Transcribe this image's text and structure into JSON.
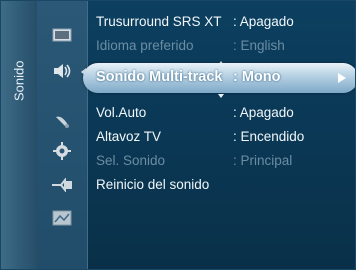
{
  "menu": {
    "category": "Sonido",
    "rows": [
      {
        "label": "Trusurround SRS XT",
        "value": ": Apagado"
      },
      {
        "label": "Idioma preferido",
        "value": ": English"
      },
      {
        "label": "Sonido Multi-track",
        "value": ": Mono"
      },
      {
        "label": "Vol.Auto",
        "value": ": Apagado"
      },
      {
        "label": "Altavoz TV",
        "value": ": Encendido"
      },
      {
        "label": "Sel. Sonido",
        "value": ": Principal"
      },
      {
        "label": "Reinicio del sonido",
        "value": ""
      }
    ]
  },
  "icons": [
    "picture-icon",
    "sound-icon",
    "channel-icon",
    "setup-icon",
    "input-icon",
    "application-icon"
  ]
}
